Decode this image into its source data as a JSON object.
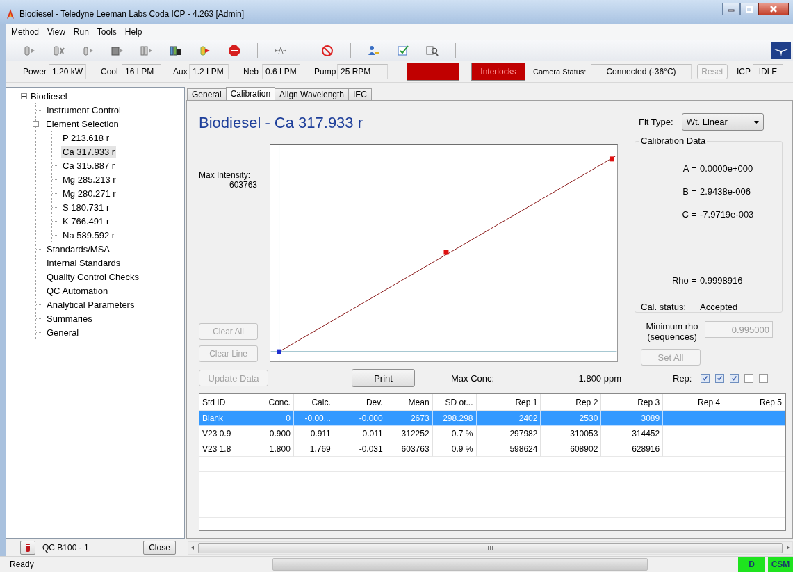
{
  "window": {
    "title": "Biodiesel - Teledyne Leeman Labs Coda ICP - 4.263  [Admin]"
  },
  "menu": [
    {
      "label": "Method"
    },
    {
      "label": "View"
    },
    {
      "label": "Run"
    },
    {
      "label": "Tools"
    },
    {
      "label": "Help"
    }
  ],
  "status_row": {
    "fields": [
      {
        "label": "Power",
        "value": "1.20 kW"
      },
      {
        "label": "Cool",
        "value": "16 LPM"
      },
      {
        "label": "Aux",
        "value": "1.2 LPM"
      },
      {
        "label": "Neb",
        "value": "0.6 LPM"
      },
      {
        "label": "Pump",
        "value": "25 RPM"
      }
    ],
    "lamps": [
      {
        "on": true
      },
      {
        "label": "Interlocks",
        "on": true
      }
    ],
    "camera": {
      "label": "Camera Status:",
      "value": "Connected (-36°C)"
    },
    "reset": {
      "label": "Reset",
      "disabled": true
    },
    "icp": {
      "label": "ICP",
      "value": "IDLE"
    }
  },
  "tree": {
    "label": "Biodiesel",
    "expanded": true,
    "selected": false,
    "children": [
      {
        "label": "Instrument Control",
        "selected": false
      },
      {
        "label": "Element Selection",
        "expanded": true,
        "selected": false,
        "children": [
          {
            "label": "P 213.618 r",
            "selected": false
          },
          {
            "label": "Ca 317.933 r",
            "selected": true
          },
          {
            "label": "Ca 315.887 r",
            "selected": false
          },
          {
            "label": "Mg 285.213 r",
            "selected": false
          },
          {
            "label": "Mg 280.271 r",
            "selected": false
          },
          {
            "label": "S 180.731 r",
            "selected": false
          },
          {
            "label": "K 766.491 r",
            "selected": false
          },
          {
            "label": "Na 589.592 r",
            "selected": false
          }
        ]
      },
      {
        "label": "Standards/MSA",
        "selected": false
      },
      {
        "label": "Internal Standards",
        "selected": false
      },
      {
        "label": "Quality Control Checks",
        "selected": false
      },
      {
        "label": "QC Automation",
        "selected": false
      },
      {
        "label": "Analytical Parameters",
        "selected": false
      },
      {
        "label": "Summaries",
        "selected": false
      },
      {
        "label": "General",
        "selected": false
      }
    ]
  },
  "tabs": [
    {
      "label": "General",
      "selected": false
    },
    {
      "label": "Calibration",
      "selected": true
    },
    {
      "label": "Align Wavelength",
      "selected": false
    },
    {
      "label": "IEC",
      "selected": false
    }
  ],
  "calibration": {
    "heading": "Biodiesel - Ca 317.933 r",
    "max_intensity": {
      "label": "Max Intensity:",
      "value": "603763"
    },
    "buttons": [
      {
        "label": "Clear All",
        "disabled": true
      },
      {
        "label": "Clear Line",
        "disabled": true
      }
    ],
    "fit_type": {
      "label": "Fit Type:",
      "value": "Wt. Linear"
    },
    "calibration_data": {
      "title": "Calibration Data",
      "coefficients": [
        {
          "label": "A =",
          "value": "0.0000e+000"
        },
        {
          "label": "B =",
          "value": "2.9438e-006"
        },
        {
          "label": "C =",
          "value": "-7.9719e-003"
        }
      ],
      "rho": {
        "label": "Rho =",
        "value": "0.9998916"
      },
      "status": {
        "label": "Cal. status:",
        "value": "Accepted"
      }
    },
    "minimum_rho": {
      "label": "Minimum rho (sequences)",
      "value": "0.995000",
      "disabled": true
    },
    "set_all": {
      "label": "Set All",
      "disabled": true
    },
    "update_data": {
      "label": "Update Data",
      "disabled": true
    },
    "print": {
      "label": "Print",
      "disabled": false
    },
    "max_conc": {
      "label": "Max Conc:",
      "value": "1.800 ppm"
    },
    "rep": {
      "label": "Rep:",
      "boxes": [
        {
          "checked": true
        },
        {
          "checked": true
        },
        {
          "checked": true
        },
        {
          "checked": false
        },
        {
          "checked": false
        }
      ]
    }
  },
  "table": {
    "columns": [
      "Std ID",
      "Conc.",
      "Calc.",
      "Dev.",
      "Mean",
      "SD or...",
      "Rep 1",
      "Rep 2",
      "Rep 3",
      "Rep 4",
      "Rep 5"
    ],
    "rows": [
      {
        "selected": true,
        "cells": [
          "Blank",
          "0",
          "-0.00...",
          "-0.000",
          "2673",
          "298.298",
          "2402",
          "2530",
          "3089",
          "",
          ""
        ]
      },
      {
        "selected": false,
        "cells": [
          "V23 0.9",
          "0.900",
          "0.911",
          "0.011",
          "312252",
          "0.7 %",
          "297982",
          "310053",
          "314452",
          "",
          ""
        ]
      },
      {
        "selected": false,
        "cells": [
          "V23 1.8",
          "1.800",
          "1.769",
          "-0.031",
          "603763",
          "0.9 %",
          "598624",
          "608902",
          "628916",
          "",
          ""
        ]
      }
    ]
  },
  "qc": {
    "label": "QC B100 - 1",
    "close": "Close"
  },
  "status_bar": {
    "text": "Ready",
    "indicators": [
      {
        "label": "D",
        "on": true
      },
      {
        "label": "CSM",
        "on": true
      }
    ]
  }
}
